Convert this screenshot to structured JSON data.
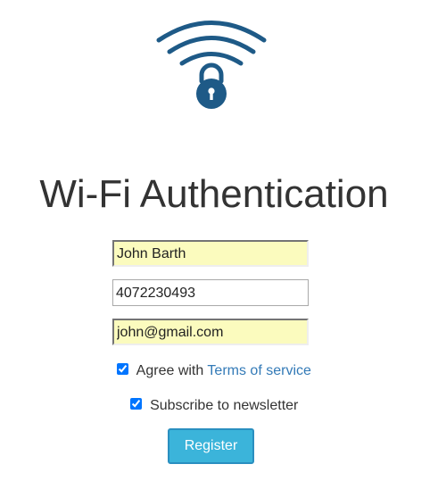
{
  "logo": {
    "icon": "wifi-lock-icon",
    "color": "#1e5a87"
  },
  "page_title": "Wi-Fi Authentication",
  "form": {
    "name_value": "John Barth",
    "phone_value": "4072230493",
    "email_value": "john@gmail.com",
    "agree_checked": true,
    "agree_prefix": "Agree with",
    "terms_link": "Terms of service",
    "subscribe_checked": true,
    "subscribe_label": "Subscribe to newsletter",
    "register_label": "Register"
  },
  "colors": {
    "autofill_bg": "#fbfbbe",
    "link": "#337ab7",
    "button_bg": "#3bb4da",
    "button_border": "#2a8fc0"
  }
}
